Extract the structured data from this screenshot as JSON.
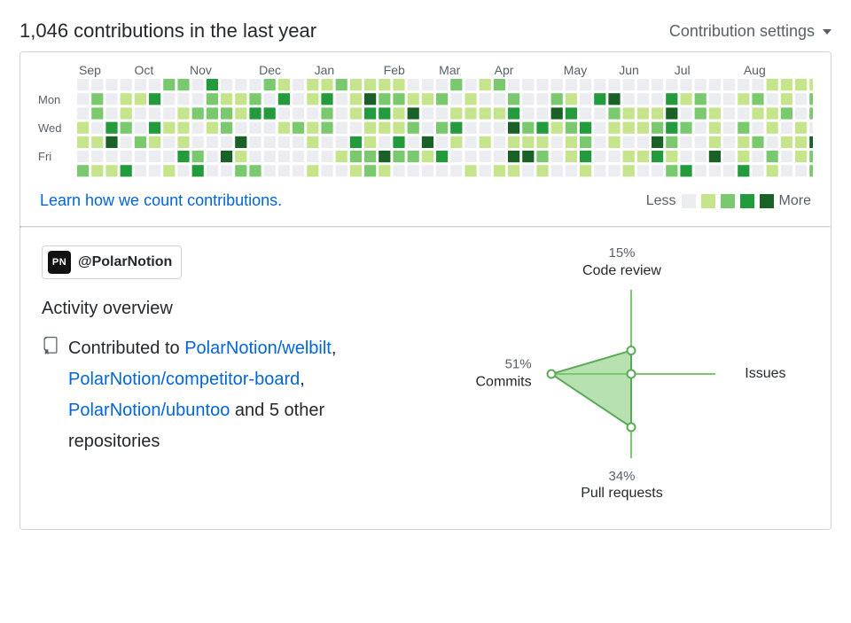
{
  "header": {
    "title": "1,046 contributions in the last year",
    "settings_label": "Contribution settings"
  },
  "calendar": {
    "months": [
      "Sep",
      "Oct",
      "Nov",
      "Dec",
      "Jan",
      "Feb",
      "Mar",
      "Apr",
      "May",
      "Jun",
      "Jul",
      "Aug"
    ],
    "month_widths_weeks": [
      4,
      4,
      5,
      4,
      5,
      4,
      4,
      5,
      4,
      4,
      5,
      5
    ],
    "day_labels": [
      "Mon",
      "Wed",
      "Fri"
    ],
    "learn_link": "Learn how we count contributions.",
    "legend_less": "Less",
    "legend_more": "More",
    "colors": [
      "#ebedf0",
      "#c6e48b",
      "#7bc96f",
      "#239a3b",
      "#196127"
    ]
  },
  "org": {
    "avatar_text": "PN",
    "handle": "@PolarNotion"
  },
  "overview": {
    "title": "Activity overview",
    "contributed_prefix": "Contributed to ",
    "repos": [
      {
        "name": "PolarNotion/welbilt"
      },
      {
        "name": "PolarNotion/competitor-board"
      },
      {
        "name": "PolarNotion/ubuntoo"
      }
    ],
    "and_others": "and 5 other repositories"
  },
  "chart_data": {
    "type": "radar",
    "axes": [
      {
        "label": "Code review",
        "percent": 15
      },
      {
        "label": "Issues",
        "percent": 0
      },
      {
        "label": "Pull requests",
        "percent": 34
      },
      {
        "label": "Commits",
        "percent": 51
      }
    ]
  }
}
